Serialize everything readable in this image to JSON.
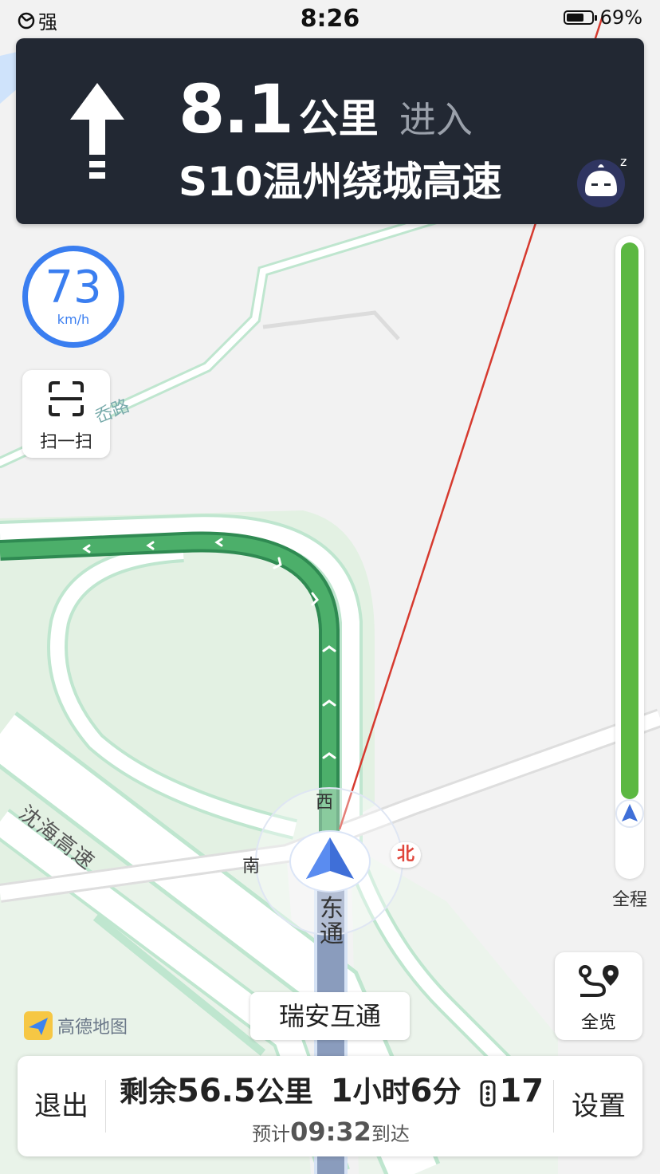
{
  "status_bar": {
    "signal": "强",
    "time": "8:26",
    "battery": "69%",
    "battery_level": 0.69
  },
  "guidance": {
    "distance": "8.1",
    "unit": "公里",
    "action": "进入",
    "road": "S10温州绕城高速",
    "turn_icon": "arrow-straight-icon",
    "assistant_icon": "robot-assistant-icon",
    "assistant_badge": "z"
  },
  "speed": {
    "value": "73",
    "unit": "km/h"
  },
  "scan": {
    "label": "扫一扫",
    "icon": "scan-icon"
  },
  "route_progress": {
    "label": "全程",
    "completed": 0.96
  },
  "map": {
    "road_labels": {
      "highway": "沈海高速",
      "small_road": "岙路",
      "interchange_road": "东通"
    },
    "compass": {
      "west": "西",
      "south": "南",
      "north": "北"
    },
    "exit_label": "瑞安互通",
    "logo": "高德地图"
  },
  "overview": {
    "label": "全览",
    "icon": "route-overview-icon"
  },
  "bottom_bar": {
    "exit": "退出",
    "remaining_prefix": "剩余",
    "remaining_distance": "56.5",
    "remaining_unit": "公里",
    "duration_hours": "1",
    "duration_hours_unit": "小时",
    "duration_minutes": "6",
    "duration_minutes_unit": "分",
    "traffic_lights": "17",
    "eta_prefix": "预计",
    "eta_time": "09:32",
    "eta_suffix": "到达",
    "settings": "设置"
  },
  "colors": {
    "route_green": "#4caf6a",
    "panel_dark": "#222833",
    "speed_blue": "#3a7ef0",
    "progress_green": "#5cb842",
    "direction_red": "#d63a2f"
  }
}
